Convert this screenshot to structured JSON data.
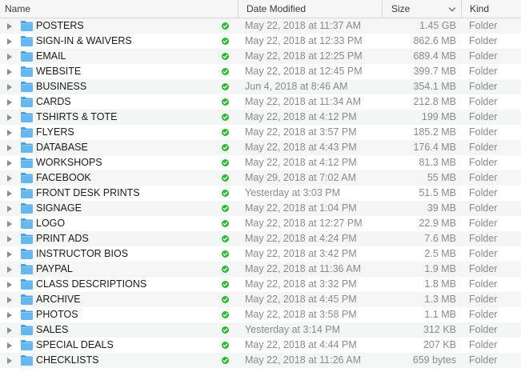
{
  "header": {
    "name": "Name",
    "date_modified": "Date Modified",
    "size": "Size",
    "kind": "Kind",
    "sort_indicator": "chevron-down-icon"
  },
  "colors": {
    "folder_blue": "#5fb1ea",
    "status_green": "#34b53a",
    "secondary_text": "#8a8a8a"
  },
  "rows": [
    {
      "name": "POSTERS",
      "date": "May 22, 2018 at 11:37 AM",
      "size": "1.45 GB",
      "kind": "Folder"
    },
    {
      "name": "SIGN-IN & WAIVERS",
      "date": "May 22, 2018 at 12:33 PM",
      "size": "862.6 MB",
      "kind": "Folder"
    },
    {
      "name": "EMAIL",
      "date": "May 22, 2018 at 12:25 PM",
      "size": "689.4 MB",
      "kind": "Folder"
    },
    {
      "name": "WEBSITE",
      "date": "May 22, 2018 at 12:45 PM",
      "size": "399.7 MB",
      "kind": "Folder"
    },
    {
      "name": "BUSINESS",
      "date": "Jun 4, 2018 at 8:46 AM",
      "size": "354.1 MB",
      "kind": "Folder"
    },
    {
      "name": "CARDS",
      "date": "May 22, 2018 at 11:34 AM",
      "size": "212.8 MB",
      "kind": "Folder"
    },
    {
      "name": "TSHIRTS & TOTE",
      "date": "May 22, 2018 at 4:12 PM",
      "size": "199 MB",
      "kind": "Folder"
    },
    {
      "name": "FLYERS",
      "date": "May 22, 2018 at 3:57 PM",
      "size": "185.2 MB",
      "kind": "Folder"
    },
    {
      "name": "DATABASE",
      "date": "May 22, 2018 at 4:43 PM",
      "size": "176.4 MB",
      "kind": "Folder"
    },
    {
      "name": "WORKSHOPS",
      "date": "May 22, 2018 at 4:12 PM",
      "size": "81.3 MB",
      "kind": "Folder"
    },
    {
      "name": "FACEBOOK",
      "date": "May 29, 2018 at 7:02 AM",
      "size": "55 MB",
      "kind": "Folder"
    },
    {
      "name": "FRONT DESK PRINTS",
      "date": "Yesterday at 3:03 PM",
      "size": "51.5 MB",
      "kind": "Folder"
    },
    {
      "name": "SIGNAGE",
      "date": "May 22, 2018 at 1:04 PM",
      "size": "39 MB",
      "kind": "Folder"
    },
    {
      "name": "LOGO",
      "date": "May 22, 2018 at 12:27 PM",
      "size": "22.9 MB",
      "kind": "Folder"
    },
    {
      "name": "PRINT ADS",
      "date": "May 22, 2018 at 4:24 PM",
      "size": "7.6 MB",
      "kind": "Folder"
    },
    {
      "name": "INSTRUCTOR BIOS",
      "date": "May 22, 2018 at 3:42 PM",
      "size": "2.5 MB",
      "kind": "Folder"
    },
    {
      "name": "PAYPAL",
      "date": "May 22, 2018 at 11:36 AM",
      "size": "1.9 MB",
      "kind": "Folder"
    },
    {
      "name": "CLASS DESCRIPTIONS",
      "date": "May 22, 2018 at 3:32 PM",
      "size": "1.8 MB",
      "kind": "Folder"
    },
    {
      "name": "ARCHIVE",
      "date": "May 22, 2018 at 4:45 PM",
      "size": "1.3 MB",
      "kind": "Folder"
    },
    {
      "name": "PHOTOS",
      "date": "May 22, 2018 at 3:58 PM",
      "size": "1.1 MB",
      "kind": "Folder"
    },
    {
      "name": "SALES",
      "date": "Yesterday at 3:14 PM",
      "size": "312 KB",
      "kind": "Folder"
    },
    {
      "name": "SPECIAL DEALS",
      "date": "May 22, 2018 at 4:44 PM",
      "size": "207 KB",
      "kind": "Folder"
    },
    {
      "name": "CHECKLISTS",
      "date": "May 22, 2018 at 11:26 AM",
      "size": "659 bytes",
      "kind": "Folder"
    }
  ]
}
